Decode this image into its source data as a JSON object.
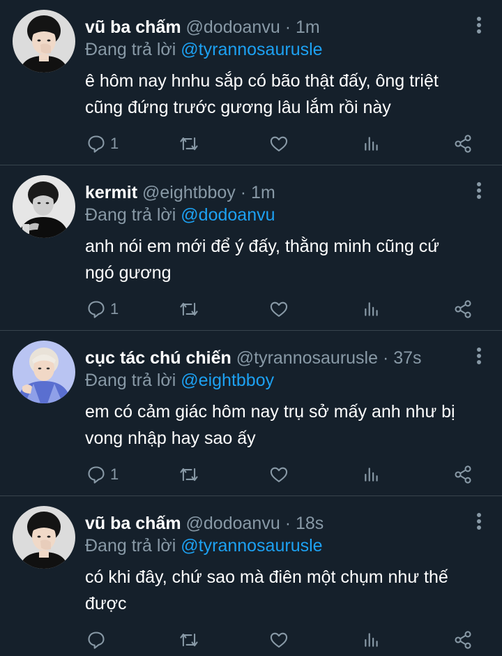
{
  "tweets": [
    {
      "avatar": "avatar-boy-hand-on-face",
      "name": "vũ ba chấm",
      "handle": "@dodoanvu",
      "time": "1m",
      "reply_prefix": "Đang trả lời",
      "reply_to": "@tyrannosaurusle",
      "text_lines": [
        "ê hôm nay hnhu sắp có bão thật đấy, ông triệt",
        "cũng đứng trước gương lâu lắm rồi này"
      ],
      "reply_count": "1"
    },
    {
      "avatar": "avatar-boy-black-white",
      "name": "kermit",
      "handle": "@eightbboy",
      "time": "1m",
      "reply_prefix": "Đang trả lời",
      "reply_to": "@dodoanvu",
      "text_lines": [
        "anh nói em mới để ý đấy, thằng minh cũng cứ",
        "ngó gương"
      ],
      "reply_count": "1"
    },
    {
      "avatar": "avatar-boy-blue-background",
      "name": "cục tác chú chiến",
      "handle": "@tyrannosaurusle",
      "time": "37s",
      "reply_prefix": "Đang trả lời",
      "reply_to": "@eightbboy",
      "text_lines": [
        "em có cảm giác hôm nay trụ sở mấy anh như bị",
        "vong nhập hay sao ấy"
      ],
      "reply_count": "1"
    },
    {
      "avatar": "avatar-boy-hand-on-face",
      "name": "vũ ba chấm",
      "handle": "@dodoanvu",
      "time": "18s",
      "reply_prefix": "Đang trả lời",
      "reply_to": "@tyrannosaurusle",
      "text_lines": [
        "có khi đây, chứ sao mà điên một chụm như thế",
        "được"
      ],
      "reply_count": ""
    }
  ],
  "separator": "·",
  "icons": [
    "reply-icon",
    "retweet-icon",
    "like-icon",
    "stats-icon",
    "share-icon",
    "more-icon"
  ],
  "colors": {
    "background": "#15202b",
    "text": "#ffffff",
    "muted": "#8899a6",
    "link": "#1da1f2",
    "divider": "#38444d"
  }
}
